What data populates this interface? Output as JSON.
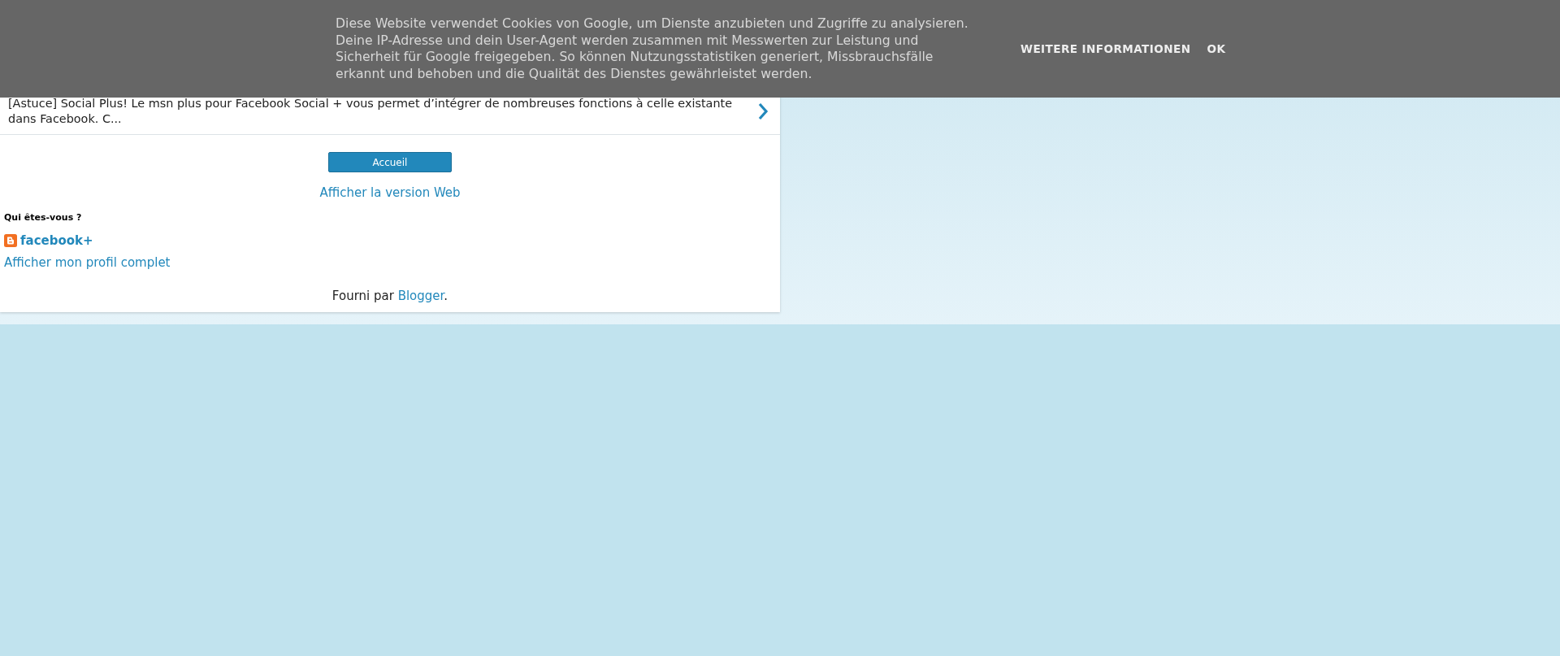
{
  "cookie_banner": {
    "message": "Diese Website verwendet Cookies von Google, um Dienste anzubieten und Zugriffe zu analysieren. Deine IP-Adresse und dein User-Agent werden zusammen mit Messwerten zur Leistung und Sicherheit für Google freigegeben. So können Nutzungsstatistiken generiert, Missbrauchsfälle erkannt und behoben und die Qualität des Dienstes gewährleistet werden.",
    "buttons": [
      "WEITERE INFORMATIONEN",
      "OK"
    ]
  },
  "post_snippet": {
    "text": "[Astuce] Social Plus! Le msn plus pour Facebook Social + vous permet d’intégrer de nombreuses fonctions à celle existante dans Facebook. C..."
  },
  "home_button": "Accueil",
  "web_version_link": "Afficher la version Web",
  "profile": {
    "heading": "Qui êtes-vous ?",
    "name": "facebook+",
    "profile_link": "Afficher mon profil complet"
  },
  "footer": {
    "prefix": "Fourni par",
    "link": "Blogger",
    "suffix": "."
  }
}
